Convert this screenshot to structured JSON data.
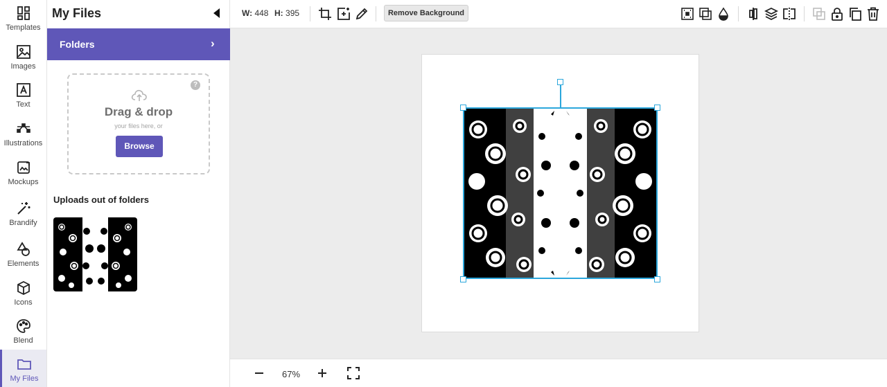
{
  "rail": {
    "items": [
      {
        "label": "Templates",
        "icon": "templates-icon"
      },
      {
        "label": "Images",
        "icon": "image-icon"
      },
      {
        "label": "Text",
        "icon": "text-icon"
      },
      {
        "label": "Illustrations",
        "icon": "illustrations-icon"
      },
      {
        "label": "Mockups",
        "icon": "mockups-icon"
      },
      {
        "label": "Brandify",
        "icon": "magic-wand-icon"
      },
      {
        "label": "Elements",
        "icon": "shapes-icon"
      },
      {
        "label": "Icons",
        "icon": "cube-icon"
      },
      {
        "label": "Blend",
        "icon": "palette-icon"
      },
      {
        "label": "My Files",
        "icon": "folder-icon",
        "active": true
      }
    ]
  },
  "panel": {
    "title": "My Files",
    "folders_label": "Folders",
    "dropzone": {
      "title": "Drag & drop",
      "subtitle": "your files here, or",
      "browse_label": "Browse",
      "help": "?"
    },
    "uploads_title": "Uploads out of folders"
  },
  "toolbar": {
    "w_label": "W:",
    "w_value": "448",
    "h_label": "H:",
    "h_value": "395",
    "remove_bg_label": "Remove Background"
  },
  "bottombar": {
    "zoom": "67%"
  },
  "colors": {
    "accent": "#5f57b8",
    "selection": "#2ba7dc"
  }
}
